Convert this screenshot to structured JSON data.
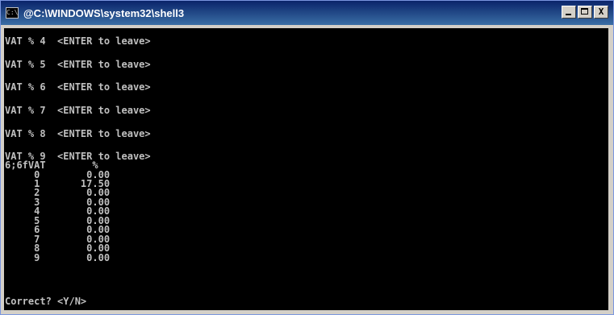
{
  "window": {
    "title": "@C:\\WINDOWS\\system32\\shell3",
    "icon_label": "C:\\",
    "buttons": {
      "minimize_icon": "minimize-icon",
      "maximize_icon": "maximize-icon",
      "close_label": "X"
    }
  },
  "console": {
    "lines": [
      "VAT % 4  <ENTER to leave>",
      "VAT % 5  <ENTER to leave>",
      "VAT % 6  <ENTER to leave>",
      "VAT % 7  <ENTER to leave>",
      "VAT % 8  <ENTER to leave>",
      "VAT % 9  <ENTER to leave>",
      "6;6fVAT        %",
      "     0        0.00",
      "     1       17.50",
      "     2        0.00",
      "     3        0.00",
      "     4        0.00",
      "     5        0.00",
      "     6        0.00",
      "     7        0.00",
      "     8        0.00",
      "     9        0.00",
      "Correct? <Y/N>"
    ]
  },
  "colors": {
    "console_background": "#000000",
    "console_text": "#c0c0c0",
    "titlebar_start": "#0a246a",
    "titlebar_end": "#3a6ea5"
  }
}
